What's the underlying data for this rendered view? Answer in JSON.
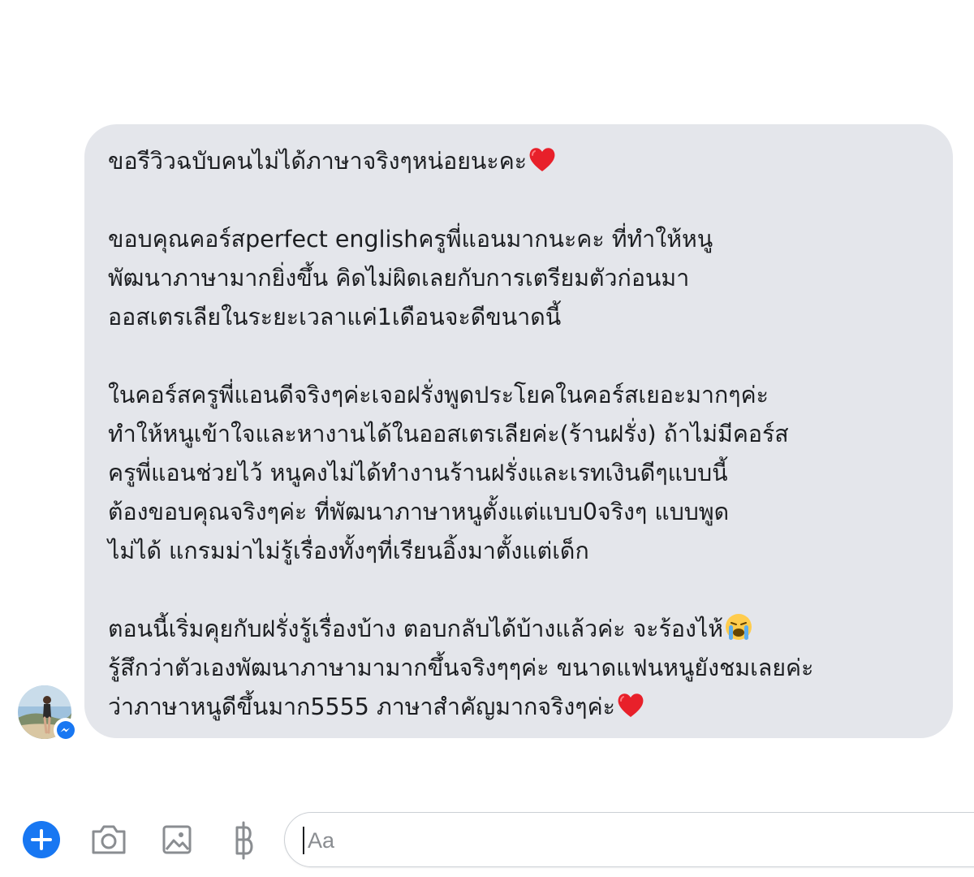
{
  "message": {
    "lines": [
      "ขอรีวิวฉบับคนไม่ได้ภาษาจริงๆหน่อยนะคะ",
      "ขอบคุณคอร์สperfect englishครูพี่แอนมากนะคะ ที่ทำให้หนู",
      "พัฒนาภาษามากยิ่งขึ้น คิดไม่ผิดเลยกับการเตรียมตัวก่อนมา",
      "ออสเตรเลียในระยะเวลาแค่1เดือนจะดีขนาดนี้",
      "ในคอร์สครูพี่แอนดีจริงๆค่ะเจอฝรั่งพูดประโยคในคอร์สเยอะมากๆค่ะ",
      "ทำให้หนูเข้าใจและหางานได้ในออสเตรเลียค่ะ(ร้านฝรั่ง) ถ้าไม่มีคอร์ส",
      "ครูพี่แอนช่วยไว้ หนูคงไม่ได้ทำงานร้านฝรั่งและเรทเงินดีๆแบบนี้",
      "ต้องขอบคุณจริงๆค่ะ ที่พัฒนาภาษาหนูตั้งแต่แบบ0จริงๆ แบบพูด",
      "ไม่ได้ แกรมม่าไม่รู้เรื่องทั้งๆที่เรียนอิ้งมาตั้งแต่เด็ก",
      "ตอนนี้เริ่มคุยกับฝรั่งรู้เรื่องบ้าง ตอบกลับได้บ้างแล้วค่ะ จะร้องไห้",
      "รู้สึกว่าตัวเองพัฒนาภาษามามากขึ้นจริงๆๆค่ะ ขนาดแฟนหนูยังชมเลยค่ะ",
      "ว่าภาษาหนูดีขึ้นมาก5555 ภาษาสำคัญมากจริงๆค่ะ"
    ],
    "emojis": [
      "red-heart",
      "loudly-crying-face",
      "red-heart"
    ]
  },
  "composer": {
    "placeholder": "Aa",
    "icons": [
      "add-icon",
      "camera-icon",
      "image-icon",
      "baht-icon"
    ]
  },
  "colors": {
    "bubble": "#e4e6eb",
    "accent": "#1877f2",
    "toolbar_icon": "#8a8d91",
    "heart": "#e8202a"
  }
}
